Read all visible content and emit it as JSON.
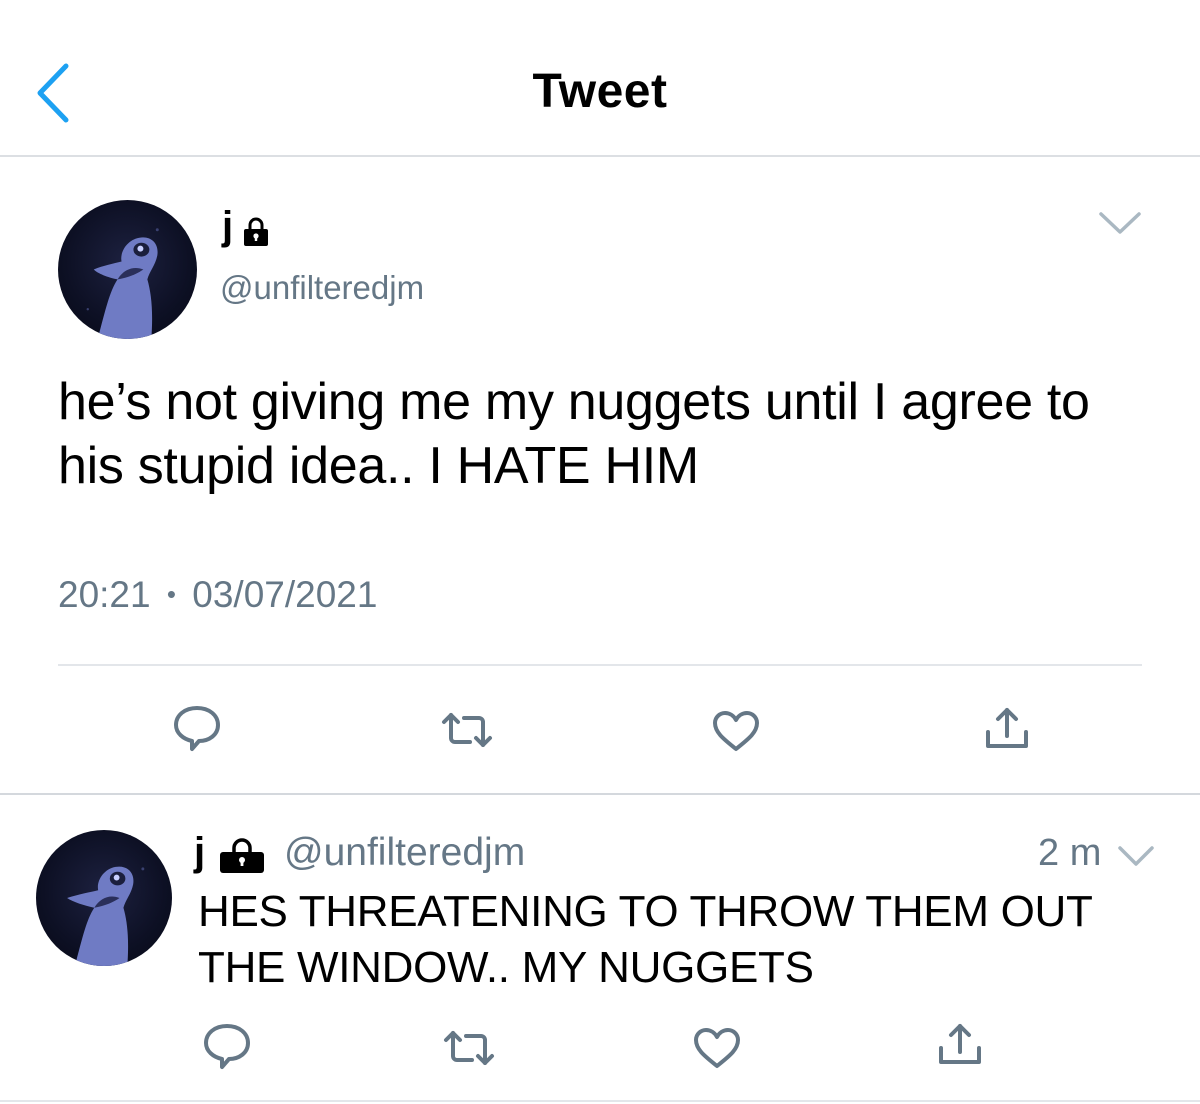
{
  "header": {
    "title": "Tweet",
    "back_icon": "chevron-left-icon",
    "accent": "#1da1f2"
  },
  "tweet": {
    "name": "j",
    "handle": "@unfilteredjm",
    "text": "he’s not giving me my nuggets until I agree to his stupid idea.. I HATE HIM",
    "time": "20:21",
    "separator": "•",
    "date": "03/07/2021",
    "actions": [
      "reply-icon",
      "retweet-icon",
      "like-icon",
      "share-icon"
    ]
  },
  "reply": {
    "name": "j",
    "handle": "@unfilteredjm",
    "time": "2 m",
    "text": "HES THREATENING TO THROW THEM OUT THE WINDOW.. MY NUGGETS",
    "actions": [
      "reply-icon",
      "retweet-icon",
      "like-icon",
      "share-icon"
    ]
  },
  "colors": {
    "text": "#000000",
    "secondary": "#657786",
    "icon": "#657786",
    "divider": "#e3e6ea"
  }
}
